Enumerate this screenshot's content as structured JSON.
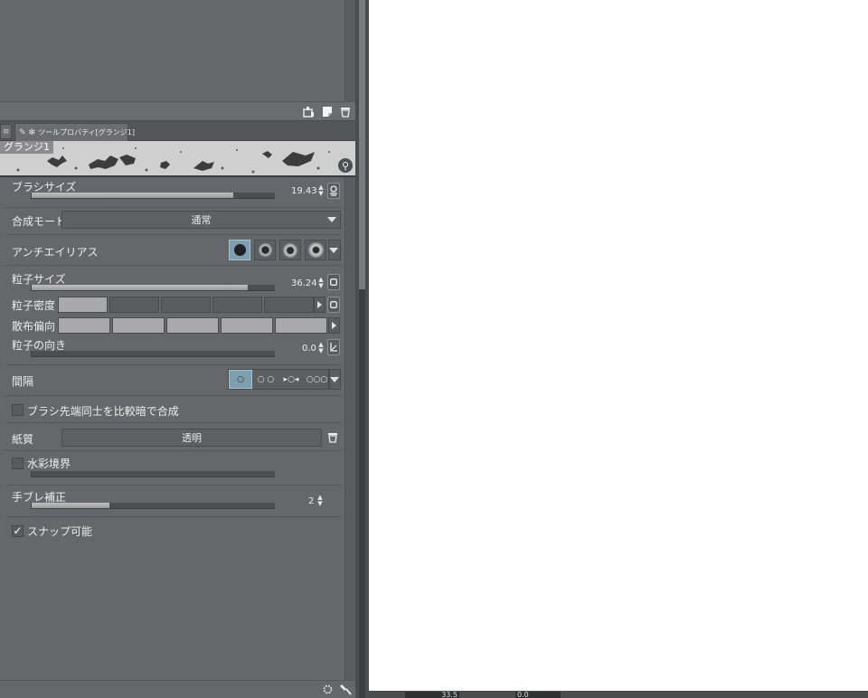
{
  "tab": {
    "title": "ツールプロパティ[グランジ1]"
  },
  "preview": {
    "name": "グランジ1"
  },
  "brush_size": {
    "label": "ブラシサイズ",
    "value": "19.43",
    "slider_fraction": 0.83
  },
  "blend_mode": {
    "label": "合成モード",
    "selected": "通常"
  },
  "antialiasing": {
    "label": "アンチエイリアス",
    "selected_index": 0
  },
  "particle_size": {
    "label": "粒子サイズ",
    "value": "36.24",
    "slider_fraction": 0.89
  },
  "particle_density": {
    "label": "粒子密度",
    "level": 1,
    "segments": 5
  },
  "scatter_bias": {
    "label": "散布偏向",
    "level": 5,
    "segments": 5
  },
  "particle_direction": {
    "label": "粒子の向き",
    "value": "0.0",
    "slider_fraction": 0.0
  },
  "spacing": {
    "label": "間隔",
    "selected_index": 0,
    "options_text": [
      "○",
      "○ ○",
      "▸○◂",
      "○○○"
    ]
  },
  "combine_tips": {
    "label": "ブラシ先端同士を比較暗で合成",
    "checked": false
  },
  "paper_texture": {
    "label": "紙質",
    "value": "透明"
  },
  "watercolor_edge": {
    "label": "水彩境界",
    "checked": false
  },
  "stabilization": {
    "label": "手ブレ補正",
    "value": "2",
    "slider_fraction": 0.32
  },
  "snap": {
    "label": "スナップ可能",
    "checked": true,
    "check_glyph": "✓"
  },
  "status_bar": {
    "zoom": "33.5",
    "angle": "0.0"
  },
  "colors": {
    "panel": "#66676b",
    "active_button": "#7f9fb0"
  }
}
